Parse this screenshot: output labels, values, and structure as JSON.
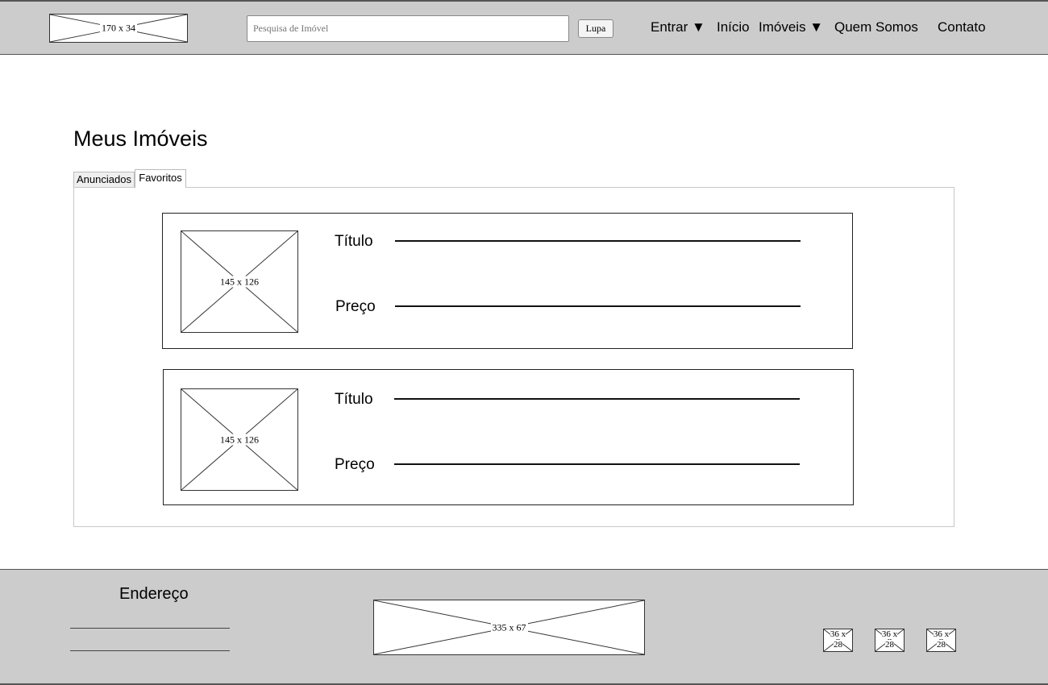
{
  "header": {
    "logo_label": "170 x 34",
    "search": {
      "placeholder": "Pesquisa de Imóvel",
      "value": "",
      "button_label": "Lupa"
    },
    "nav": {
      "entrar": "Entrar ▼",
      "inicio": "Início",
      "imoveis": "Imóveis ▼",
      "quem_somos": "Quem Somos",
      "contato": "Contato"
    }
  },
  "main": {
    "title": "Meus Imóveis",
    "tabs": [
      {
        "label": "Anunciados",
        "active": false
      },
      {
        "label": "Favoritos",
        "active": true
      }
    ],
    "cards": [
      {
        "image_label": "145 x 126",
        "title_label": "Título",
        "price_label": "Preço"
      },
      {
        "image_label": "145 x 126",
        "title_label": "Título",
        "price_label": "Preço"
      }
    ]
  },
  "footer": {
    "address_title": "Endereço",
    "logo_label": "335 x 67",
    "social_icons": [
      {
        "label_top": "36 x",
        "label_bottom": "28"
      },
      {
        "label_top": "36 x",
        "label_bottom": "28"
      },
      {
        "label_top": "36 x",
        "label_bottom": "28"
      }
    ]
  },
  "colors": {
    "bar_background": "#cccccc",
    "border": "#555555",
    "page_background": "#ffffff"
  }
}
